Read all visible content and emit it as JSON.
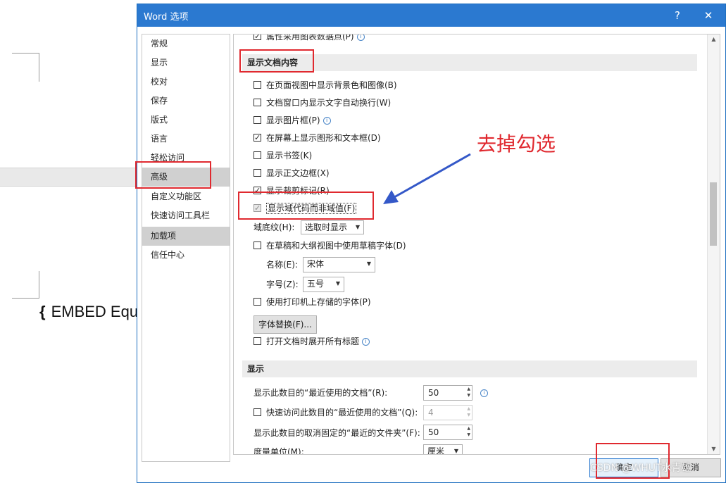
{
  "document": {
    "text": "EMBED Equ",
    "brace": "{"
  },
  "dialog": {
    "title": "Word 选项",
    "help_icon": "?",
    "close_icon": "✕"
  },
  "sidebar": {
    "items": [
      {
        "label": "常规"
      },
      {
        "label": "显示"
      },
      {
        "label": "校对"
      },
      {
        "label": "保存"
      },
      {
        "label": "版式"
      },
      {
        "label": "语言"
      },
      {
        "label": "轻松访问"
      },
      {
        "label": "高级",
        "selected": true
      },
      {
        "label": "自定义功能区"
      },
      {
        "label": "快速访问工具栏"
      },
      {
        "label": "加载项",
        "selected": true
      },
      {
        "label": "信任中心"
      }
    ]
  },
  "content": {
    "top_partial_option": {
      "label": "属性采用图表数据点(P)",
      "checked": true
    },
    "section_show_content": "显示文档内容",
    "options": [
      {
        "label": "在页面视图中显示背景色和图像(B)",
        "checked": false
      },
      {
        "label": "文档窗口内显示文字自动换行(W)",
        "checked": false
      },
      {
        "label": "显示图片框(P)",
        "checked": false,
        "info": true
      },
      {
        "label": "在屏幕上显示图形和文本框(D)",
        "checked": true
      },
      {
        "label": "显示书签(K)",
        "checked": false
      },
      {
        "label": "显示正文边框(X)",
        "checked": false
      },
      {
        "label": "显示裁剪标记(R)",
        "checked": true
      },
      {
        "label": "显示域代码而非域值(F)",
        "checked": true,
        "disabled": true
      }
    ],
    "field_shading_label": "域底纹(H):",
    "field_shading_value": "选取时显示",
    "draft_font_option": {
      "label": "在草稿和大纲视图中使用草稿字体(D)",
      "checked": false
    },
    "name_label": "名称(E):",
    "name_value": "宋体",
    "size_label": "字号(Z):",
    "size_value": "五号",
    "printer_font_option": {
      "label": "使用打印机上存储的字体(P)",
      "checked": false
    },
    "font_sub_button": "字体替换(F)...",
    "expand_headings_option": {
      "label": "打开文档时展开所有标题",
      "checked": false,
      "info": true
    },
    "section_display": "显示",
    "recent_docs_label": "显示此数目的“最近使用的文档”(R):",
    "recent_docs_value": "50",
    "quick_access_option": {
      "label": "快速访问此数目的“最近使用的文档”(Q):",
      "checked": false
    },
    "quick_access_value": "4",
    "recent_folders_label": "显示此数目的取消固定的“最近的文件夹”(F):",
    "recent_folders_value": "50",
    "units_label": "度量单位(M):",
    "units_value": "厘米"
  },
  "footer": {
    "ok": "确定",
    "cancel": "取消"
  },
  "annotation": {
    "text": "去掉勾选"
  },
  "watermark": "CSDN @WHUT水青雄",
  "colors": {
    "title_bar": "#2b79d0",
    "highlight": "#e0292f",
    "arrow": "#3458c8"
  }
}
